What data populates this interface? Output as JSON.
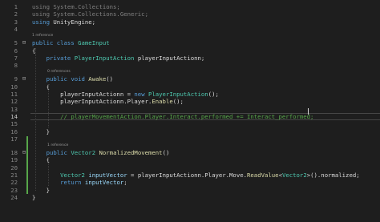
{
  "editor": {
    "theme_colors": {
      "background": "#1e1e1e",
      "keyword": "#569cd6",
      "type": "#4ec9b0",
      "method": "#dcdcaa",
      "variable": "#9cdcfe",
      "comment": "#57a64a",
      "line_number": "#858585",
      "change_bar": "#57a64a"
    },
    "current_line_number": "14",
    "lines": [
      {
        "n": "1",
        "parts": [
          {
            "c": "t-gy",
            "t": "using "
          },
          {
            "c": "t-gy",
            "t": "System.Collections;"
          }
        ]
      },
      {
        "n": "2",
        "parts": [
          {
            "c": "t-gy",
            "t": "using "
          },
          {
            "c": "t-gy",
            "t": "System.Collections.Generic;"
          }
        ]
      },
      {
        "n": "3",
        "parts": [
          {
            "c": "t-kw",
            "t": "using "
          },
          {
            "c": "t-pl",
            "t": "UnityEngine;"
          }
        ]
      },
      {
        "n": "4",
        "parts": []
      },
      {
        "lens": "1 reference"
      },
      {
        "n": "5",
        "parts": [
          {
            "c": "t-kw",
            "t": "public class "
          },
          {
            "c": "t-ty",
            "t": "GameInput"
          }
        ]
      },
      {
        "n": "6",
        "parts": [
          {
            "c": "t-pl",
            "t": "{"
          }
        ]
      },
      {
        "n": "7",
        "parts": [
          {
            "c": "t-pl",
            "t": "    "
          },
          {
            "c": "t-kw",
            "t": "private "
          },
          {
            "c": "t-ty",
            "t": "PlayerInputAction "
          },
          {
            "c": "t-pl",
            "t": "playerInputActionn;"
          }
        ]
      },
      {
        "n": "8",
        "parts": []
      },
      {
        "lens": "0 references"
      },
      {
        "n": "9",
        "parts": [
          {
            "c": "t-pl",
            "t": "    "
          },
          {
            "c": "t-kw",
            "t": "public void "
          },
          {
            "c": "t-fn",
            "t": "Awake"
          },
          {
            "c": "t-pl",
            "t": "()"
          }
        ]
      },
      {
        "n": "10",
        "parts": [
          {
            "c": "t-pl",
            "t": "    {"
          }
        ]
      },
      {
        "n": "11",
        "parts": [
          {
            "c": "t-pl",
            "t": "        playerInputActionn = "
          },
          {
            "c": "t-kw",
            "t": "new "
          },
          {
            "c": "t-ty",
            "t": "PlayerInputAction"
          },
          {
            "c": "t-pl",
            "t": "();"
          }
        ]
      },
      {
        "n": "12",
        "parts": [
          {
            "c": "t-pl",
            "t": "        playerInputActionn.Player."
          },
          {
            "c": "t-fn",
            "t": "Enable"
          },
          {
            "c": "t-pl",
            "t": "();"
          }
        ]
      },
      {
        "n": "13",
        "parts": []
      },
      {
        "n": "14",
        "parts": [
          {
            "c": "t-cm",
            "t": "        // playerMovementAction.Player.Interact.performed += Interact_performed;"
          }
        ]
      },
      {
        "n": "15",
        "parts": []
      },
      {
        "n": "16",
        "parts": [
          {
            "c": "t-pl",
            "t": "    }"
          }
        ]
      },
      {
        "n": "17",
        "parts": []
      },
      {
        "lens": "1 reference"
      },
      {
        "n": "18",
        "parts": [
          {
            "c": "t-pl",
            "t": "    "
          },
          {
            "c": "t-kw",
            "t": "public "
          },
          {
            "c": "t-ty",
            "t": "Vector2 "
          },
          {
            "c": "t-fn",
            "t": "NormalizedMovement"
          },
          {
            "c": "t-pl",
            "t": "()"
          }
        ]
      },
      {
        "n": "19",
        "parts": [
          {
            "c": "t-pl",
            "t": "    {"
          }
        ]
      },
      {
        "n": "20",
        "parts": []
      },
      {
        "n": "21",
        "parts": [
          {
            "c": "t-pl",
            "t": "        "
          },
          {
            "c": "t-ty",
            "t": "Vector2 "
          },
          {
            "c": "t-vr",
            "t": "inputVector"
          },
          {
            "c": "t-pl",
            "t": " = playerInputActionn.Player.Move."
          },
          {
            "c": "t-fn",
            "t": "ReadValue"
          },
          {
            "c": "t-pl",
            "t": "<"
          },
          {
            "c": "t-ty",
            "t": "Vector2"
          },
          {
            "c": "t-pl",
            "t": ">().normalized;"
          }
        ]
      },
      {
        "n": "22",
        "parts": [
          {
            "c": "t-pl",
            "t": "        "
          },
          {
            "c": "t-kw",
            "t": "return "
          },
          {
            "c": "t-vr",
            "t": "inputVector"
          },
          {
            "c": "t-pl",
            "t": ";"
          }
        ]
      },
      {
        "n": "23",
        "parts": [
          {
            "c": "t-pl",
            "t": "    }"
          }
        ]
      },
      {
        "n": "24",
        "parts": [
          {
            "c": "t-pl",
            "t": "}"
          }
        ]
      }
    ]
  }
}
